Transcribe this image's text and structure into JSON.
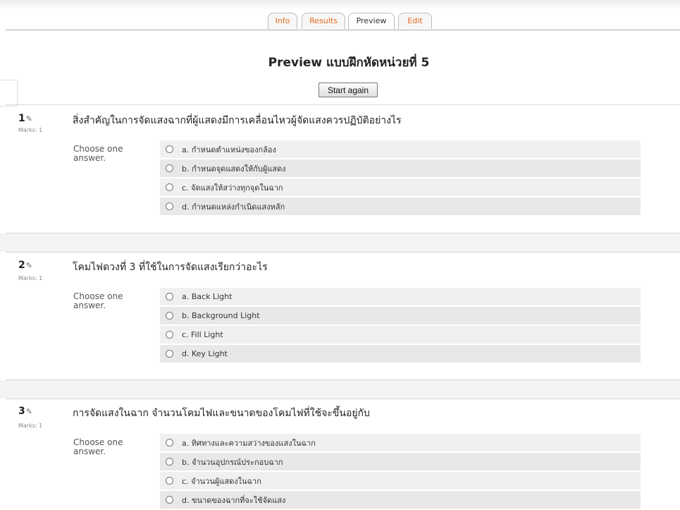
{
  "tabs": [
    {
      "label": "Info",
      "active": false
    },
    {
      "label": "Results",
      "active": false
    },
    {
      "label": "Preview",
      "active": true
    },
    {
      "label": "Edit",
      "active": false
    }
  ],
  "page_title": "Preview แบบฝึกหัดหน่วยที่ 5",
  "start_again": "Start again",
  "choose_label": "Choose one answer.",
  "marks_label": "Marks: 1",
  "questions": [
    {
      "number": "1",
      "text": "สิ่งสำคัญในการจัดแสงฉากที่ผู้แสดงมีการเคลื่อนไหวผู้จัดแสงควรปฏิบัติอย่างไร",
      "answers": [
        "a. กำหนดตำแหน่งของกล้อง",
        "b. กำหนดจุดแสดงให้กับผู้แสดง",
        "c. จัดแสงให้สว่างทุกจุดในฉาก",
        "d. กำหนดแหล่งกำเนิดแสงหลัก"
      ]
    },
    {
      "number": "2",
      "text": "โคมไฟดวงที่ 3 ที่ใช้ในการจัดแสงเรียกว่าอะไร",
      "answers": [
        "a. Back Light",
        "b. Background Light",
        "c. Fill Light",
        "d. Key Light"
      ]
    },
    {
      "number": "3",
      "text": "การจัดแสงในฉาก จำนวนโคมไฟและขนาดของโคมไฟที่ใช้จะขึ้นอยู่กับ",
      "answers": [
        "a. ทิศทางและความสว่างของแสงในฉาก",
        "b. จำนวนอุปกรณ์ประกอบฉาก",
        "c. จำนวนผู้แสดงในฉาก",
        "d. ขนาดของฉากที่จะใช้จัดแสง"
      ]
    }
  ]
}
